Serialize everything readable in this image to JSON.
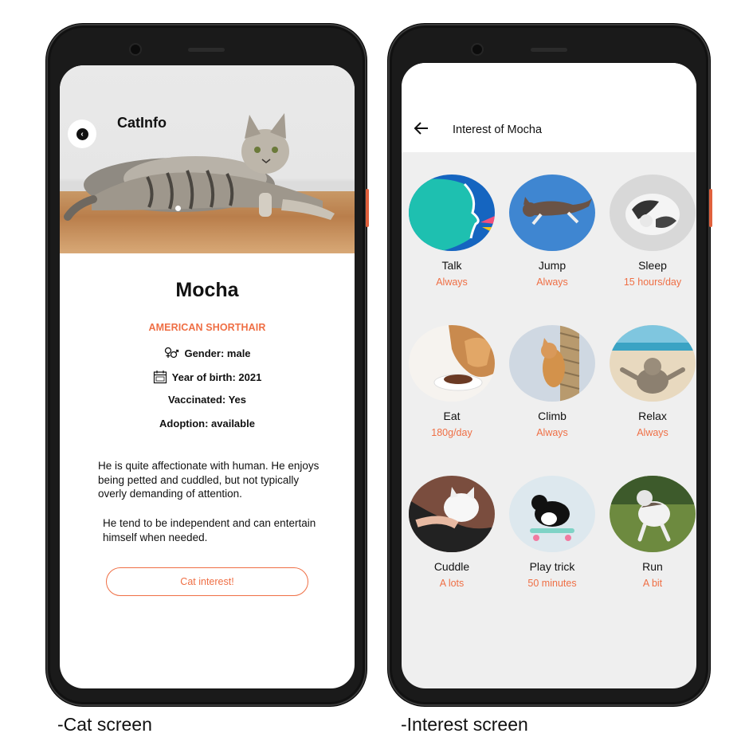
{
  "cat_screen": {
    "header_title": "CatInfo",
    "name": "Mocha",
    "breed": "AMERICAN SHORTHAIR",
    "gender": "Gender: male",
    "birth_year": "Year of birth: 2021",
    "vaccinated": "Vaccinated: Yes",
    "adoption": "Adoption: available",
    "description_1": "He is quite affectionate with human. He enjoys being petted and cuddled, but not typically overly demanding of attention.",
    "description_2": "He tend to be independent and can entertain himself when needed.",
    "cta_label": "Cat interest!"
  },
  "interest_screen": {
    "title": "Interest of Mocha",
    "items": [
      {
        "label": "Talk",
        "value": "Always"
      },
      {
        "label": "Jump",
        "value": "Always"
      },
      {
        "label": "Sleep",
        "value": "15 hours/day"
      },
      {
        "label": "Eat",
        "value": "180g/day"
      },
      {
        "label": "Climb",
        "value": "Always"
      },
      {
        "label": "Relax",
        "value": "Always"
      },
      {
        "label": "Cuddle",
        "value": "A lots"
      },
      {
        "label": "Play trick",
        "value": "50 minutes"
      },
      {
        "label": "Run",
        "value": "A bit"
      }
    ]
  },
  "captions": {
    "left": "-Cat screen",
    "right": "-Interest screen"
  },
  "colors": {
    "accent": "#ef6f45",
    "frame": "#1a1a1a"
  }
}
